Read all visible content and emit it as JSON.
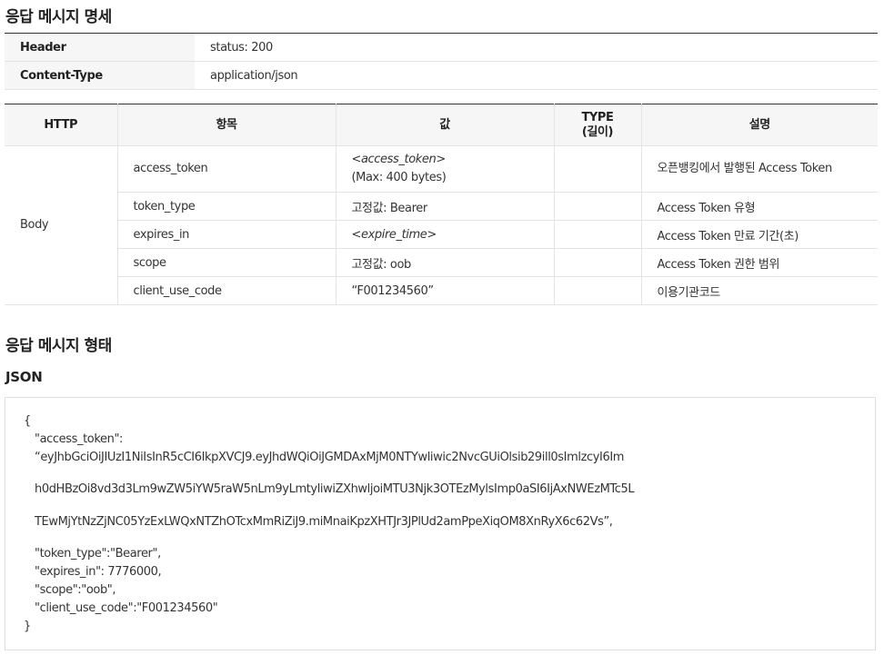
{
  "sections": {
    "spec_title": "응답 메시지 명세",
    "form_title": "응답 메시지 형태",
    "json_label": "JSON"
  },
  "header_rows": [
    {
      "key": "Header",
      "value": "status: 200"
    },
    {
      "key": "Content-Type",
      "value": "application/json"
    }
  ],
  "spec_table": {
    "columns": {
      "http": "HTTP",
      "item": "항목",
      "value": "값",
      "type_line1": "TYPE",
      "type_line2": "(길이)",
      "desc": "설명"
    },
    "group": "Body",
    "rows": [
      {
        "item": "access_token",
        "value_italic": "<access_token>",
        "value_plain": "(Max: 400 bytes)",
        "type": "",
        "desc": "오픈뱅킹에서 발행된 Access Token"
      },
      {
        "item": "token_type",
        "value_plain": "고정값: Bearer",
        "type": "",
        "desc": "Access Token 유형"
      },
      {
        "item": "expires_in",
        "value_italic": "<expire_time>",
        "type": "",
        "desc": "Access Token 만료 기간(초)"
      },
      {
        "item": "scope",
        "value_plain": "고정값: oob",
        "type": "",
        "desc": "Access Token 권한 범위"
      },
      {
        "item": "client_use_code",
        "value_plain": "“F001234560”",
        "type": "",
        "desc": "이용기관코드"
      }
    ]
  },
  "json_example": {
    "open": "{",
    "access_token_key": "\"access_token\":",
    "token_line1": "“eyJhbGciOiJIUzI1NiIsInR5cCI6IkpXVCJ9.eyJhdWQiOiJGMDAxMjM0NTYwliwic2NvcGUiOlsib29ill0sImlzcyI6Im",
    "token_line2": "h0dHBzOi8vd3d3Lm9wZW5iYW5raW5nLm9yLmtyliwiZXhwljoiMTU3Njk3OTEzMylsImp0aSI6IjAxNWEzMTc5L",
    "token_line3": "TEwMjYtNzZjNC05YzExLWQxNTZhOTcxMmRiZiJ9.miMnaiKpzXHTJr3JPlUd2amPpeXiqOM8XnRyX6c62Vs”,",
    "token_type_line": "\"token_type\":\"Bearer\",",
    "expires_in_line": "\"expires_in\": 7776000,",
    "scope_line": "\"scope\":\"oob\",",
    "client_use_code_line": "\"client_use_code\":\"F001234560\"",
    "close": "}"
  }
}
